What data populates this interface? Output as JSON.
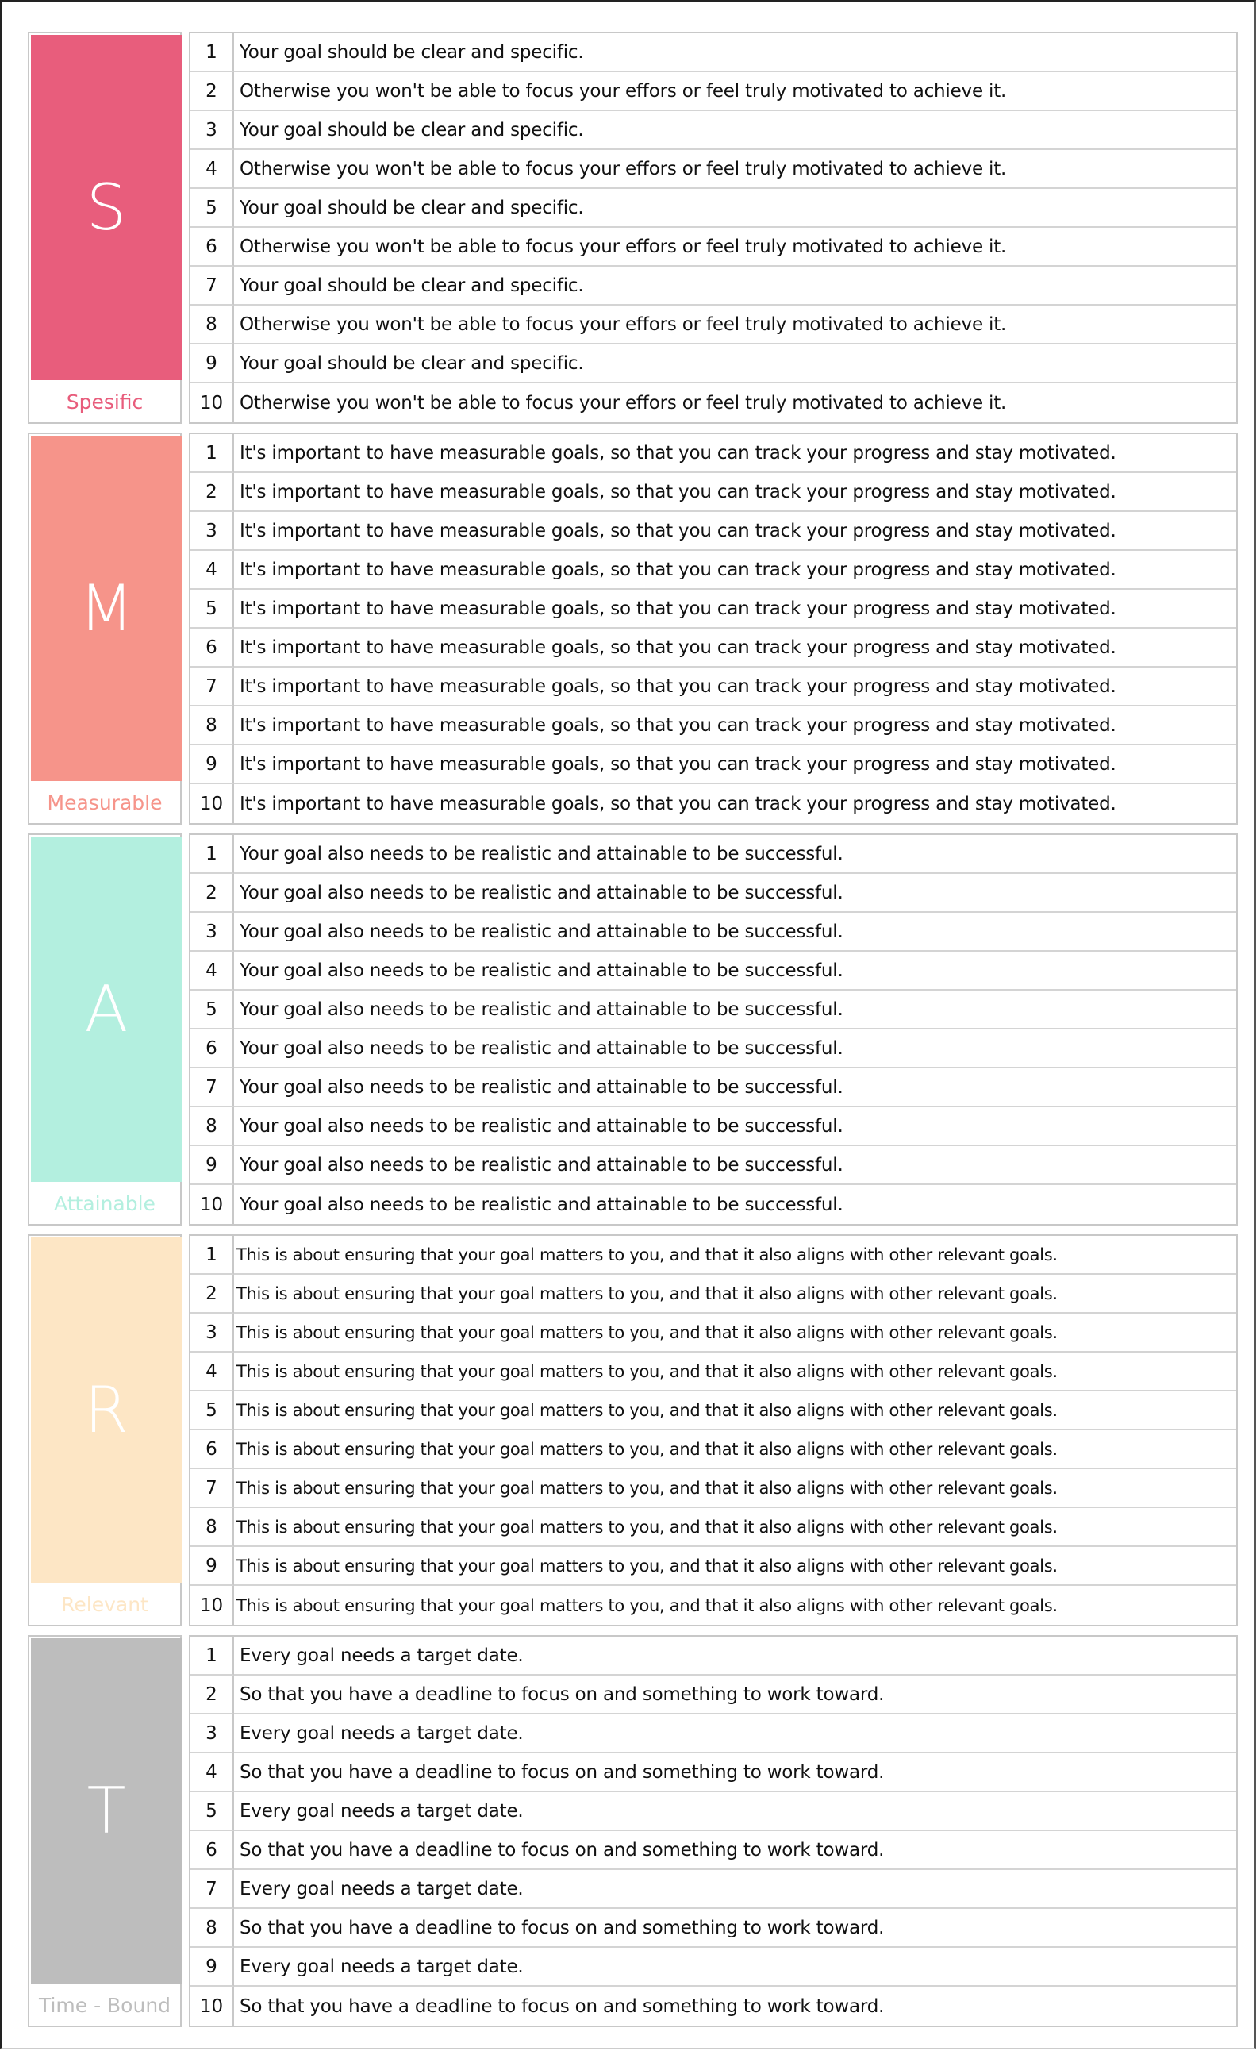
{
  "sections": [
    {
      "key": "S",
      "letter": "S",
      "word": "Spesific",
      "color": "#e85d7c",
      "word_color": "#e85d7c",
      "rows": [
        {
          "num": "1",
          "text": "Your goal should be clear and specific."
        },
        {
          "num": "2",
          "text": "Otherwise you won't be able to focus your effors or feel truly motivated to achieve it."
        },
        {
          "num": "3",
          "text": "Your goal should be clear and specific."
        },
        {
          "num": "4",
          "text": "Otherwise you won't be able to focus your effors or feel truly motivated to achieve it."
        },
        {
          "num": "5",
          "text": "Your goal should be clear and specific."
        },
        {
          "num": "6",
          "text": "Otherwise you won't be able to focus your effors or feel truly motivated to achieve it."
        },
        {
          "num": "7",
          "text": "Your goal should be clear and specific."
        },
        {
          "num": "8",
          "text": "Otherwise you won't be able to focus your effors or feel truly motivated to achieve it."
        },
        {
          "num": "9",
          "text": "Your goal should be clear and specific."
        },
        {
          "num": "10",
          "text": "Otherwise you won't be able to focus your effors or feel truly motivated to achieve it."
        }
      ]
    },
    {
      "key": "M",
      "letter": "M",
      "word": "Measurable",
      "color": "#f6948a",
      "word_color": "#f6948a",
      "rows": [
        {
          "num": "1",
          "text": "It's important to have measurable goals, so that you can track your progress and stay motivated."
        },
        {
          "num": "2",
          "text": "It's important to have measurable goals, so that you can track your progress and stay motivated."
        },
        {
          "num": "3",
          "text": "It's important to have measurable goals, so that you can track your progress and stay motivated."
        },
        {
          "num": "4",
          "text": "It's important to have measurable goals, so that you can track your progress and stay motivated."
        },
        {
          "num": "5",
          "text": "It's important to have measurable goals, so that you can track your progress and stay motivated."
        },
        {
          "num": "6",
          "text": "It's important to have measurable goals, so that you can track your progress and stay motivated."
        },
        {
          "num": "7",
          "text": "It's important to have measurable goals, so that you can track your progress and stay motivated."
        },
        {
          "num": "8",
          "text": "It's important to have measurable goals, so that you can track your progress and stay motivated."
        },
        {
          "num": "9",
          "text": "It's important to have measurable goals, so that you can track your progress and stay motivated."
        },
        {
          "num": "10",
          "text": "It's important to have measurable goals, so that you can track your progress and stay motivated."
        }
      ]
    },
    {
      "key": "A",
      "letter": "A",
      "word": "Attainable",
      "color": "#b3efdf",
      "word_color": "#b3efdf",
      "rows": [
        {
          "num": "1",
          "text": "Your goal also needs to be realistic and attainable to be successful."
        },
        {
          "num": "2",
          "text": "Your goal also needs to be realistic and attainable to be successful."
        },
        {
          "num": "3",
          "text": "Your goal also needs to be realistic and attainable to be successful."
        },
        {
          "num": "4",
          "text": "Your goal also needs to be realistic and attainable to be successful."
        },
        {
          "num": "5",
          "text": "Your goal also needs to be realistic and attainable to be successful."
        },
        {
          "num": "6",
          "text": "Your goal also needs to be realistic and attainable to be successful."
        },
        {
          "num": "7",
          "text": "Your goal also needs to be realistic and attainable to be successful."
        },
        {
          "num": "8",
          "text": "Your goal also needs to be realistic and attainable to be successful."
        },
        {
          "num": "9",
          "text": "Your goal also needs to be realistic and attainable to be successful."
        },
        {
          "num": "10",
          "text": "Your goal also needs to be realistic and attainable to be successful."
        }
      ]
    },
    {
      "key": "R",
      "letter": "R",
      "word": "Relevant",
      "color": "#fde6c5",
      "word_color": "#fde6c5",
      "rows": [
        {
          "num": "1",
          "text": "This is about ensuring that your goal matters to you, and that it also aligns with other relevant goals."
        },
        {
          "num": "2",
          "text": "This is about ensuring that your goal matters to you, and that it also aligns with other relevant goals."
        },
        {
          "num": "3",
          "text": "This is about ensuring that your goal matters to you, and that it also aligns with other relevant goals."
        },
        {
          "num": "4",
          "text": "This is about ensuring that your goal matters to you, and that it also aligns with other relevant goals."
        },
        {
          "num": "5",
          "text": "This is about ensuring that your goal matters to you, and that it also aligns with other relevant goals."
        },
        {
          "num": "6",
          "text": "This is about ensuring that your goal matters to you, and that it also aligns with other relevant goals."
        },
        {
          "num": "7",
          "text": "This is about ensuring that your goal matters to you, and that it also aligns with other relevant goals."
        },
        {
          "num": "8",
          "text": "This is about ensuring that your goal matters to you, and that it also aligns with other relevant goals."
        },
        {
          "num": "9",
          "text": "This is about ensuring that your goal matters to you, and that it also aligns with other relevant goals."
        },
        {
          "num": "10",
          "text": "This is about ensuring that your goal matters to you, and that it also aligns with other relevant goals."
        }
      ]
    },
    {
      "key": "T",
      "letter": "T",
      "word": "Time - Bound",
      "color": "#bdbdbd",
      "word_color": "#bdbdbd",
      "rows": [
        {
          "num": "1",
          "text": "Every goal needs a target date."
        },
        {
          "num": "2",
          "text": "So that you have a deadline to focus on and something to work toward."
        },
        {
          "num": "3",
          "text": "Every goal needs a target date."
        },
        {
          "num": "4",
          "text": "So that you have a deadline to focus on and something to work toward."
        },
        {
          "num": "5",
          "text": "Every goal needs a target date."
        },
        {
          "num": "6",
          "text": "So that you have a deadline to focus on and something to work toward."
        },
        {
          "num": "7",
          "text": "Every goal needs a target date."
        },
        {
          "num": "8",
          "text": "So that you have a deadline to focus on and something to work toward."
        },
        {
          "num": "9",
          "text": "Every goal needs a target date."
        },
        {
          "num": "10",
          "text": "So that you have a deadline to focus on and something to work toward."
        }
      ]
    }
  ]
}
